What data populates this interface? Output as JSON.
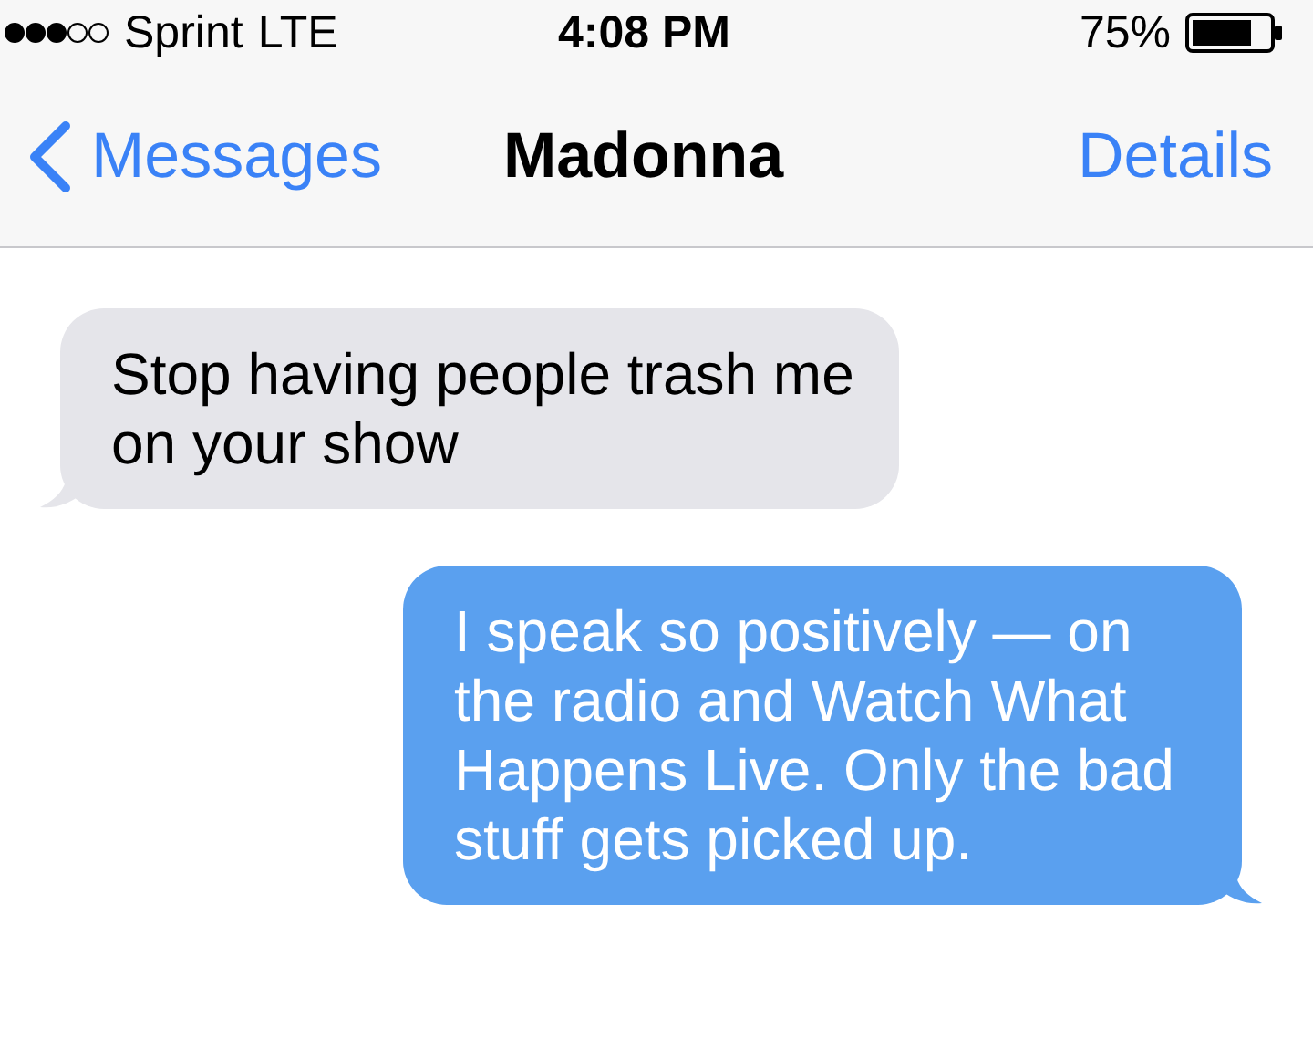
{
  "status_bar": {
    "carrier": "Sprint",
    "network": "LTE",
    "time": "4:08 PM",
    "battery": "75%"
  },
  "nav": {
    "back": "Messages",
    "title": "Madonna",
    "action": "Details"
  },
  "messages": [
    {
      "kind": "incoming",
      "text": "Stop having people trash me on your show"
    },
    {
      "kind": "outgoing",
      "text": "I speak so positively — on the radio and Watch What Happens Live. Only the bad stuff gets picked up."
    }
  ]
}
